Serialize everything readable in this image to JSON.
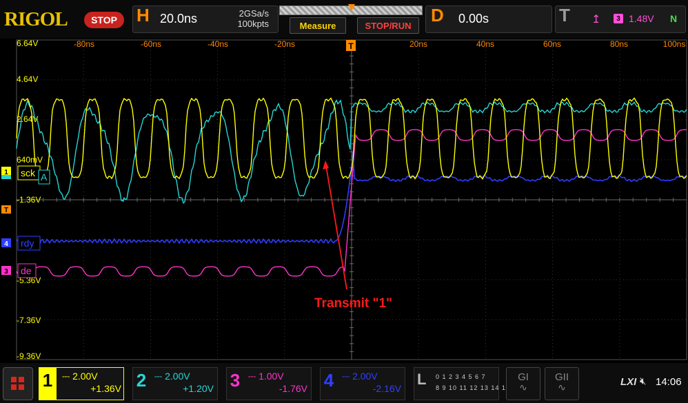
{
  "header": {
    "logo": "RIGOL",
    "run_state": "STOP",
    "horizontal": {
      "letter": "H",
      "timebase": "20.0ns",
      "sample_rate": "2GSa/s",
      "memory_depth": "100kpts"
    },
    "measure_label": "Measure",
    "stop_run_label": "STOP/RUN",
    "delay": {
      "letter": "D",
      "value": "0.00s"
    },
    "trigger": {
      "letter": "T",
      "source": "3",
      "level": "1.48V",
      "mode": "N"
    }
  },
  "graticule": {
    "time_labels": [
      "-80ns",
      "-60ns",
      "-40ns",
      "-20ns",
      "20ns",
      "40ns",
      "60ns",
      "80ns",
      "100ns"
    ],
    "volt_labels": [
      "6.64V",
      "4.64V",
      "2.64V",
      "640mV",
      "-1.36V",
      "-5.36V",
      "-7.36V",
      "-9.36V"
    ],
    "trigger_marker": "T"
  },
  "channel_markers": [
    {
      "num": "1",
      "label": "sck",
      "color": "#ffff00"
    },
    {
      "num": "2",
      "label": "A",
      "color": "#27d6d6"
    },
    {
      "num": "4",
      "label": "rdy",
      "color": "#3040ff"
    },
    {
      "num": "3",
      "label": "de",
      "color": "#ff33cc"
    }
  ],
  "annotation": {
    "text": "Transmit \"1\"",
    "color": "#ff1a1a"
  },
  "channels": [
    {
      "num": "1",
      "scale": "2.00V",
      "offset": "+1.36V",
      "color": "#ffff00"
    },
    {
      "num": "2",
      "scale": "2.00V",
      "offset": "+1.20V",
      "color": "#27d6d6"
    },
    {
      "num": "3",
      "scale": "1.00V",
      "offset": "-1.76V",
      "color": "#ff33cc"
    },
    {
      "num": "4",
      "scale": "2.00V",
      "offset": "-2.16V",
      "color": "#3040ff"
    }
  ],
  "logic": {
    "letter": "L",
    "row1": "0 1 2 3  4 5 6 7",
    "row2": "8 9 10 11 12 13 14 15"
  },
  "decode_buttons": [
    "GI",
    "GII"
  ],
  "status": {
    "lxi": "LXI",
    "time": "14:06"
  }
}
